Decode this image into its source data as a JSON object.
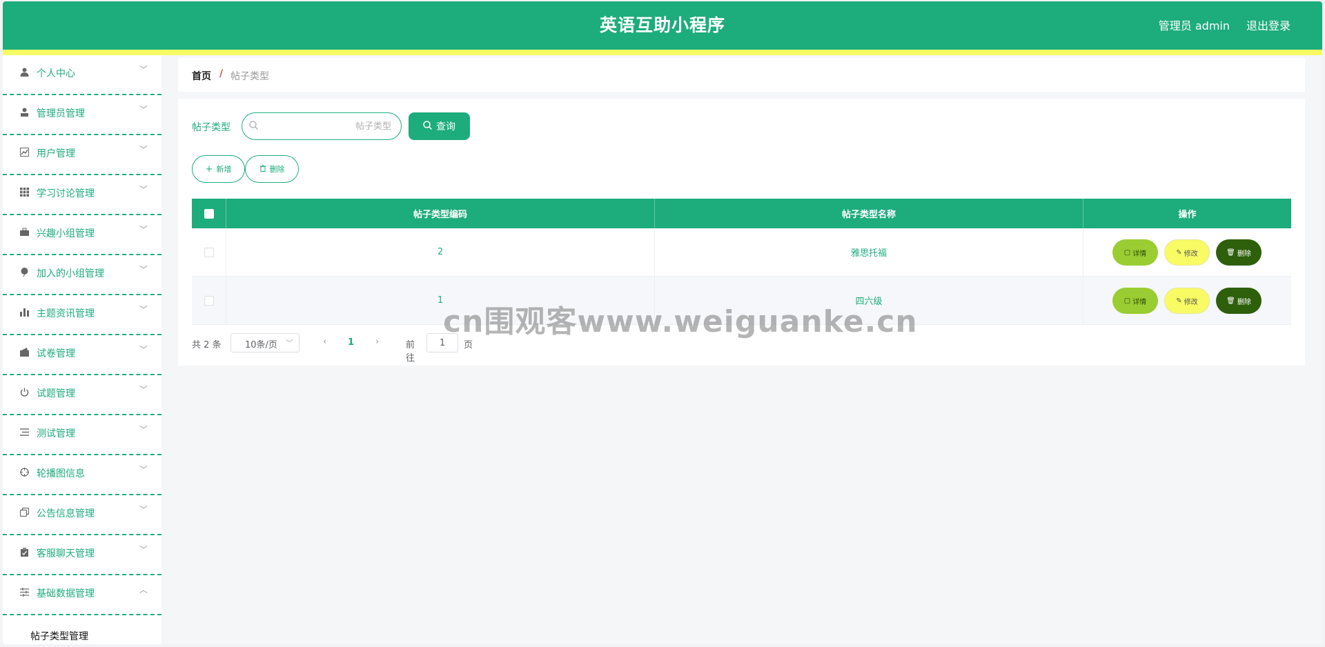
{
  "header": {
    "title": "英语互助小程序",
    "user": "管理员 admin",
    "logout": "退出登录"
  },
  "sidebar": {
    "items": [
      {
        "label": "个人中心",
        "icon": "user-icon"
      },
      {
        "label": "管理员管理",
        "icon": "admin-icon"
      },
      {
        "label": "用户管理",
        "icon": "chart-line-icon"
      },
      {
        "label": "学习讨论管理",
        "icon": "grid-icon"
      },
      {
        "label": "兴趣小组管理",
        "icon": "briefcase-icon"
      },
      {
        "label": "加入的小组管理",
        "icon": "balloon-icon"
      },
      {
        "label": "主题资讯管理",
        "icon": "bar-chart-icon"
      },
      {
        "label": "试卷管理",
        "icon": "wallet-icon"
      },
      {
        "label": "试题管理",
        "icon": "power-icon"
      },
      {
        "label": "测试管理",
        "icon": "list-icon"
      },
      {
        "label": "轮播图信息",
        "icon": "target-icon"
      },
      {
        "label": "公告信息管理",
        "icon": "copy-icon"
      },
      {
        "label": "客服聊天管理",
        "icon": "clipboard-icon"
      },
      {
        "label": "基础数据管理",
        "icon": "sliders-icon"
      }
    ],
    "subitem": "帖子类型管理"
  },
  "breadcrumb": {
    "home": "首页",
    "separator": "/",
    "current": "帖子类型"
  },
  "search": {
    "label": "帖子类型",
    "placeholder": "帖子类型",
    "query_button": "查询"
  },
  "actions": {
    "add": "新增",
    "delete": "删除"
  },
  "table": {
    "headers": [
      "帖子类型编码",
      "帖子类型名称",
      "操作"
    ],
    "rows": [
      {
        "code": "2",
        "name": "雅思托福"
      },
      {
        "code": "1",
        "name": "四六级"
      }
    ],
    "row_actions": {
      "detail": "详情",
      "edit": "修改",
      "delete": "删除"
    }
  },
  "pagination": {
    "total": "共 2 条",
    "page_size": "10条/页",
    "current": "1",
    "goto": "前往",
    "goto_value": "1",
    "page_suffix": "页"
  },
  "watermark": "cn围观客www.weiguanke.cn",
  "colors": {
    "primary": "#1dac7b",
    "accent_yellow": "#f8fb63",
    "detail_button": "#9acd32",
    "delete_button": "#2e5f0b"
  }
}
